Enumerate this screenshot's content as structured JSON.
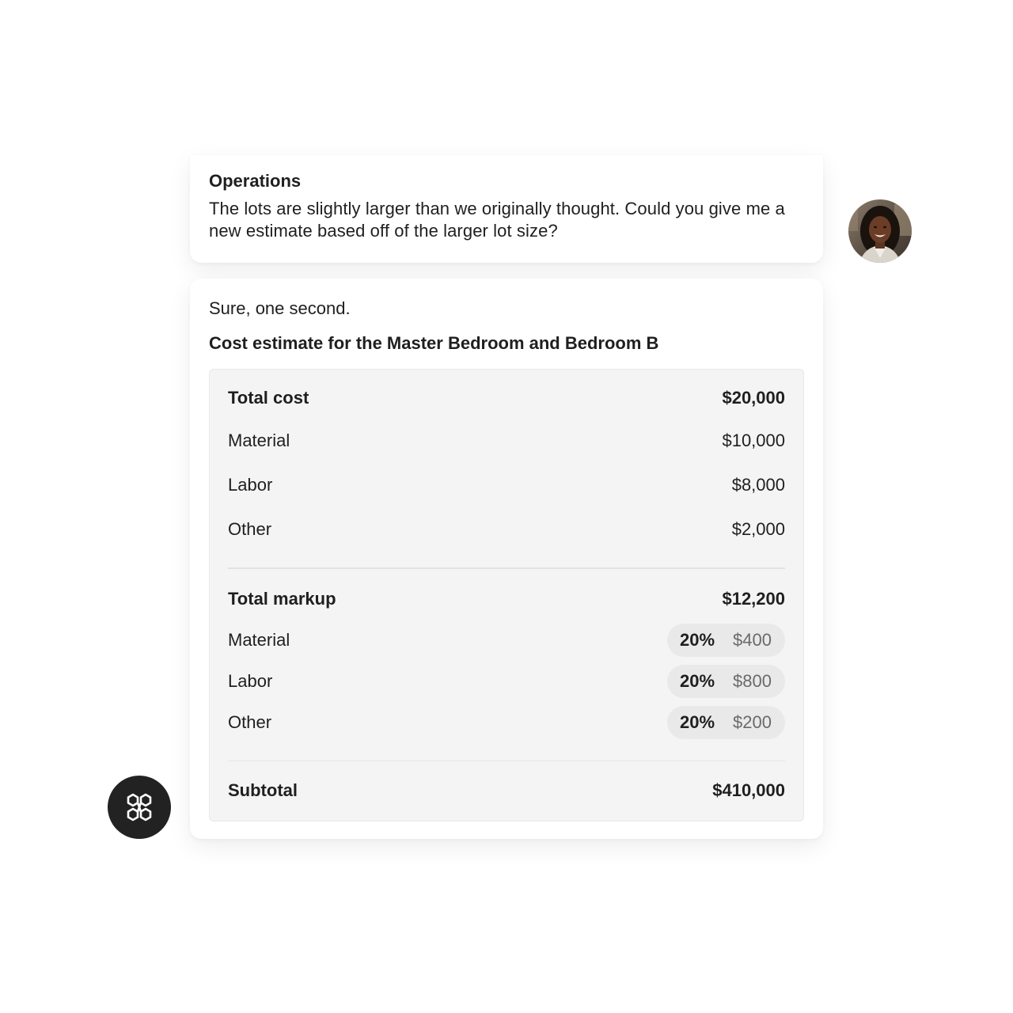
{
  "user_message": {
    "sender": "Operations",
    "text": "The lots are slightly larger than we originally thought. Could you give me a new estimate based off of the larger lot size?"
  },
  "bot_message": {
    "intro": "Sure, one second.",
    "title": "Cost estimate for the Master Bedroom and Bedroom B",
    "total_cost": {
      "label": "Total cost",
      "value": "$20,000",
      "items": [
        {
          "label": "Material",
          "value": "$10,000"
        },
        {
          "label": "Labor",
          "value": "$8,000"
        },
        {
          "label": "Other",
          "value": "$2,000"
        }
      ]
    },
    "total_markup": {
      "label": "Total markup",
      "value": "$12,200",
      "items": [
        {
          "label": "Material",
          "percent": "20%",
          "amount": "$400"
        },
        {
          "label": "Labor",
          "percent": "20%",
          "amount": "$800"
        },
        {
          "label": "Other",
          "percent": "20%",
          "amount": "$200"
        }
      ]
    },
    "subtotal": {
      "label": "Subtotal",
      "value": "$410,000"
    }
  },
  "icons": {
    "avatar": "user-avatar",
    "assistant": "assistant-logo-icon"
  },
  "colors": {
    "card_bg": "#ffffff",
    "table_bg": "#f4f4f4",
    "pill_bg": "#e9e9e9",
    "assistant_icon_bg": "#222222",
    "muted_text": "#6a6a6a"
  }
}
